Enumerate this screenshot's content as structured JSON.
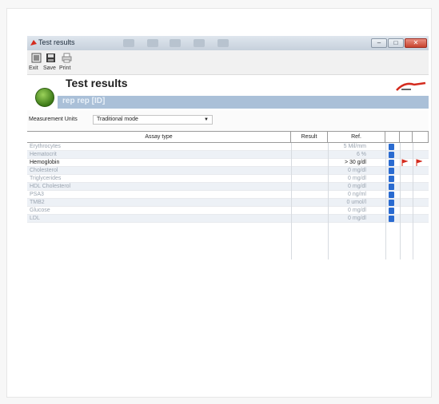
{
  "window": {
    "title": "Test results",
    "buttons": [
      "–",
      "□",
      "✕"
    ]
  },
  "toolbar": {
    "exit_label": "Exit",
    "save_label": "Save",
    "print_label": "Print"
  },
  "header": {
    "title": "Test results",
    "patient": "rep rep  [ID]"
  },
  "units": {
    "label": "Measurement Units",
    "value": "Traditional mode"
  },
  "table": {
    "columns": [
      "Assay type",
      "Result",
      "Ref."
    ],
    "rows": [
      {
        "name": "Erythrocytes",
        "result": "5 Mil/mm",
        "highlight": false
      },
      {
        "name": "Hematocrit",
        "result": "6 %",
        "highlight": false
      },
      {
        "name": "Hemoglobin",
        "result": "> 30 g/dl",
        "highlight": true
      },
      {
        "name": "Cholesterol",
        "result": "0 mg/dl",
        "highlight": false
      },
      {
        "name": "Triglycerides",
        "result": "0 mg/dl",
        "highlight": false
      },
      {
        "name": "HDL Cholesterol",
        "result": "0 mg/dl",
        "highlight": false
      },
      {
        "name": "PSA3",
        "result": "0 ng/ml",
        "highlight": false
      },
      {
        "name": "TMB2",
        "result": "0 umol/l",
        "highlight": false
      },
      {
        "name": "Glucose",
        "result": "0 mg/dl",
        "highlight": false
      },
      {
        "name": "LDL",
        "result": "0 mg/dl",
        "highlight": false
      }
    ]
  },
  "colors": {
    "patient_bar": "#aac0d8",
    "info": "#2a6bd0",
    "flag": "#d42b1e"
  }
}
